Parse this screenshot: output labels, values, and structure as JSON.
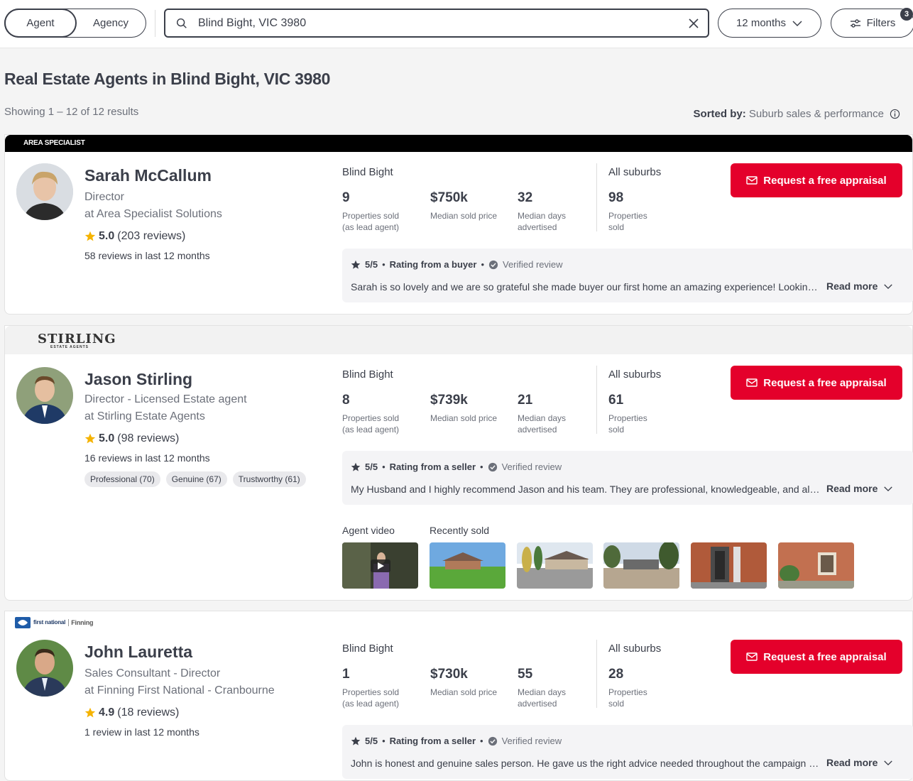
{
  "topbar": {
    "tab_agent": "Agent",
    "tab_agency": "Agency",
    "search_value": "Blind Bight, VIC 3980",
    "period_label": "12 months",
    "filters_label": "Filters",
    "filters_count": "3"
  },
  "page": {
    "title": "Real Estate Agents in Blind Bight, VIC 3980",
    "showing": "Showing 1 – 12 of 12 results",
    "sorted_label": "Sorted by:",
    "sorted_value": "Suburb sales & performance"
  },
  "colors": {
    "accent": "#e4002b",
    "text": "#3b3f4a",
    "star": "#f5b301"
  },
  "agents": [
    {
      "brand": "AREA SPECIALIST",
      "name": "Sarah McCallum",
      "role": "Director",
      "agency": "at Area Specialist Solutions",
      "rating": "5.0",
      "reviews": "(203 reviews)",
      "recent": "58 reviews in last 12 months",
      "suburb_heading": "Blind Bight",
      "sold": "9",
      "sold_label_1": "Properties sold",
      "sold_label_2": "(as lead agent)",
      "price": "$750k",
      "price_label": "Median sold price",
      "days": "32",
      "days_label_1": "Median days",
      "days_label_2": "advertised",
      "all_heading": "All suburbs",
      "all_sold": "98",
      "all_label": "Properties sold",
      "cta": "Request a free appraisal",
      "review_score": "5/5",
      "review_from": "Rating from a buyer",
      "review_verified": "Verified review",
      "review_text": "Sarah is so lovely and we are so grateful she made buyer our first home an amazing experience! Looking for a great agent in the area, Sarah is the one.",
      "read_more": "Read more"
    },
    {
      "brand": "STIRLING",
      "brand_sub": "ESTATE AGENTS",
      "name": "Jason Stirling",
      "role": "Director - Licensed Estate agent",
      "agency": "at Stirling Estate Agents",
      "rating": "5.0",
      "reviews": "(98 reviews)",
      "recent": "16 reviews in last 12 months",
      "tags": [
        "Professional (70)",
        "Genuine (67)",
        "Trustworthy (61)"
      ],
      "suburb_heading": "Blind Bight",
      "sold": "8",
      "sold_label_1": "Properties sold",
      "sold_label_2": "(as lead agent)",
      "price": "$739k",
      "price_label": "Median sold price",
      "days": "21",
      "days_label_1": "Median days",
      "days_label_2": "advertised",
      "all_heading": "All suburbs",
      "all_sold": "61",
      "all_label": "Properties sold",
      "cta": "Request a free appraisal",
      "review_score": "5/5",
      "review_from": "Rating from a seller",
      "review_verified": "Verified review",
      "review_text": "My Husband and I highly recommend Jason and his team. They are professional, knowledgeable, and always available.",
      "read_more": "Read more",
      "video_label": "Agent video",
      "sold_label": "Recently sold"
    },
    {
      "brand": "first national",
      "brand_sub": "Finning",
      "name": "John Lauretta",
      "role": "Sales Consultant - Director",
      "agency": "at Finning First National - Cranbourne",
      "rating": "4.9",
      "reviews": "(18 reviews)",
      "recent": "1 review in last 12 months",
      "suburb_heading": "Blind Bight",
      "sold": "1",
      "sold_label_1": "Properties sold",
      "sold_label_2": "(as lead agent)",
      "price": "$730k",
      "price_label": "Median sold price",
      "days": "55",
      "days_label_1": "Median days",
      "days_label_2": "advertised",
      "all_heading": "All suburbs",
      "all_sold": "28",
      "all_label": "Properties sold",
      "cta": "Request a free appraisal",
      "review_score": "5/5",
      "review_from": "Rating from a seller",
      "review_verified": "Verified review",
      "review_text": "John is honest and genuine sales person. He gave us the right advice needed throughout the campaign and got a great result.",
      "read_more": "Read more"
    }
  ]
}
